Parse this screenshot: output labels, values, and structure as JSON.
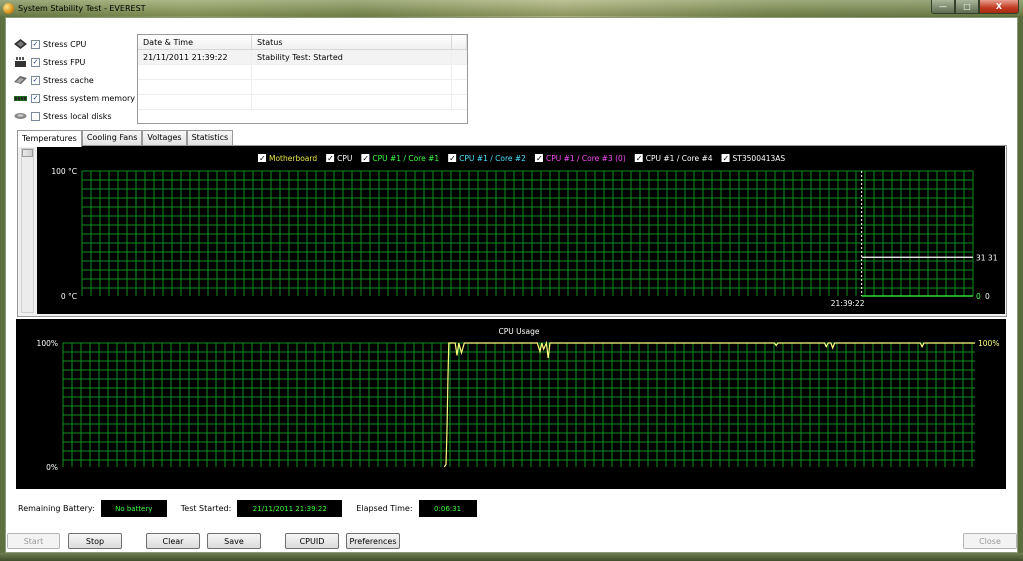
{
  "window": {
    "title": "System Stability Test - EVEREST",
    "min_glyph": "—",
    "max_glyph": "□",
    "close_glyph": "X"
  },
  "stress_options": [
    {
      "label": "Stress CPU",
      "checked": true,
      "icon": "cpu-icon"
    },
    {
      "label": "Stress FPU",
      "checked": true,
      "icon": "fpu-icon"
    },
    {
      "label": "Stress cache",
      "checked": true,
      "icon": "cache-icon"
    },
    {
      "label": "Stress system memory",
      "checked": true,
      "icon": "memory-icon"
    },
    {
      "label": "Stress local disks",
      "checked": false,
      "icon": "disk-icon"
    }
  ],
  "log": {
    "headers": [
      "Date & Time",
      "Status"
    ],
    "rows": [
      {
        "datetime": "21/11/2011 21:39:22",
        "status": "Stability Test: Started"
      }
    ]
  },
  "tabs": [
    "Temperatures",
    "Cooling Fans",
    "Voltages",
    "Statistics"
  ],
  "active_tab": "Temperatures",
  "chart_data": [
    {
      "type": "line",
      "title": "",
      "legend": [
        {
          "name": "Motherboard",
          "color": "#e8e84a",
          "checked": true
        },
        {
          "name": "CPU",
          "color": "#ffffff",
          "checked": true
        },
        {
          "name": "CPU #1 / Core #1",
          "color": "#3dff3d",
          "checked": true
        },
        {
          "name": "CPU #1 / Core #2",
          "color": "#4be3ff",
          "checked": true
        },
        {
          "name": "CPU #1 / Core #3 (0)",
          "color": "#ff4bff",
          "checked": true
        },
        {
          "name": "CPU #1 / Core #4",
          "color": "#ffffff",
          "checked": true
        },
        {
          "name": "ST3500413AS",
          "color": "#ffffff",
          "checked": true
        }
      ],
      "ylim": [
        0,
        100
      ],
      "y_tick_labels": [
        "100 °C",
        "0 °C"
      ],
      "x_tick_labels": [
        "21:39:22"
      ],
      "marker_time": "21:39:22",
      "grid": true,
      "start_fraction": 0.875,
      "series": [
        {
          "name": "temperature-high",
          "color": "#ffffff",
          "value": 31
        },
        {
          "name": "temperature-low",
          "color": "#3dff3d",
          "value": 0
        }
      ],
      "right_labels": [
        {
          "text": "31 31",
          "value": 31,
          "color": "#ffffff"
        },
        {
          "text": "0",
          "value": 0,
          "color": "#3dff3d"
        },
        {
          "text": "0",
          "value": 0,
          "color": "#ffffff"
        }
      ]
    },
    {
      "type": "line",
      "title": "CPU Usage",
      "ylim": [
        0,
        100
      ],
      "y_tick_labels": [
        "100%",
        "0%"
      ],
      "right_label": "100%",
      "grid": true,
      "line_color": "#ffff80",
      "series": [
        {
          "name": "CPU Usage",
          "points": [
            [
              0.418,
              0
            ],
            [
              0.42,
              2
            ],
            [
              0.421,
              30
            ],
            [
              0.422,
              70
            ],
            [
              0.423,
              100
            ],
            [
              0.43,
              100
            ],
            [
              0.432,
              90
            ],
            [
              0.434,
              100
            ],
            [
              0.437,
              92
            ],
            [
              0.44,
              100
            ],
            [
              0.52,
              100
            ],
            [
              0.523,
              93
            ],
            [
              0.525,
              100
            ],
            [
              0.527,
              95
            ],
            [
              0.53,
              100
            ],
            [
              0.532,
              88
            ],
            [
              0.534,
              100
            ],
            [
              0.78,
              100
            ],
            [
              0.782,
              98
            ],
            [
              0.784,
              100
            ],
            [
              0.835,
              100
            ],
            [
              0.837,
              97
            ],
            [
              0.839,
              100
            ],
            [
              0.842,
              100
            ],
            [
              0.844,
              96
            ],
            [
              0.846,
              100
            ],
            [
              0.94,
              100
            ],
            [
              0.942,
              97
            ],
            [
              0.944,
              100
            ],
            [
              1.0,
              100
            ]
          ]
        }
      ]
    }
  ],
  "status": {
    "battery_label": "Remaining Battery:",
    "battery_value": "No battery",
    "started_label": "Test Started:",
    "started_value": "21/11/2011 21:39:22",
    "elapsed_label": "Elapsed Time:",
    "elapsed_value": "0:06:31"
  },
  "buttons": {
    "start": "Start",
    "stop": "Stop",
    "clear": "Clear",
    "save": "Save",
    "cpuid": "CPUID",
    "preferences": "Preferences",
    "close": "Close"
  },
  "colors": {
    "grid": "#0f8f20",
    "chart_bg": "#000000",
    "status_text": "#3dff3d"
  }
}
